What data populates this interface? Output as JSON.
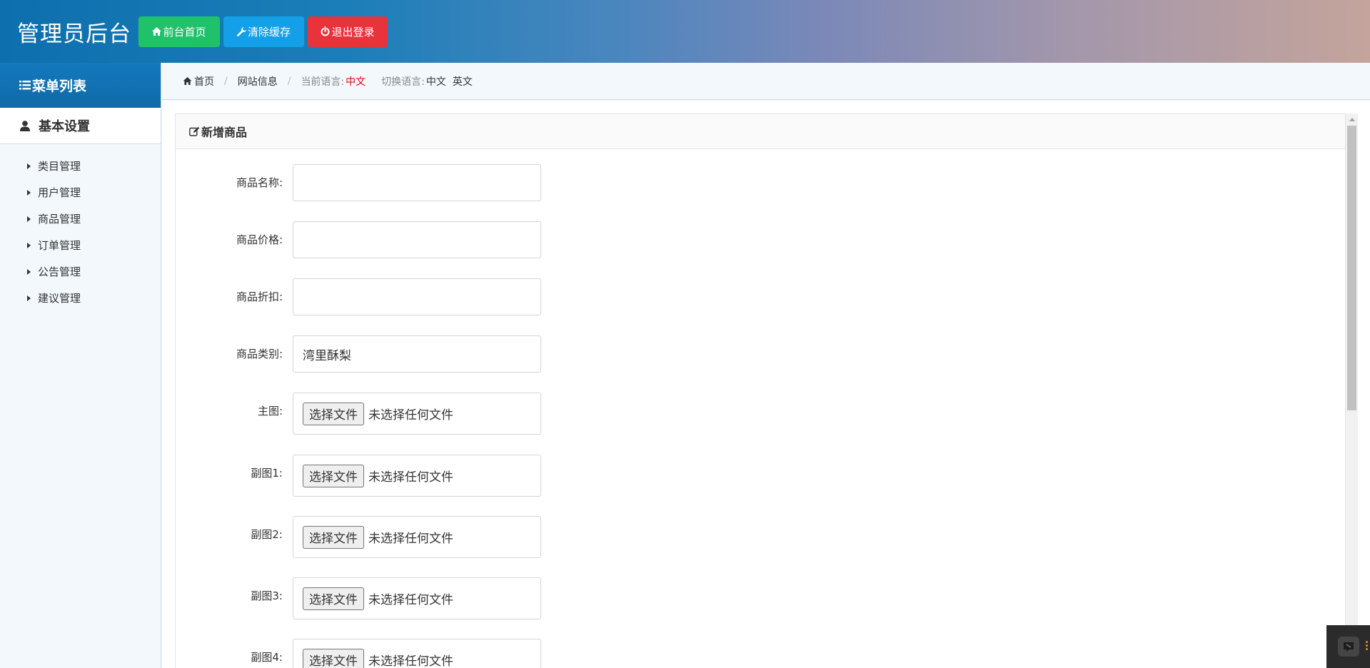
{
  "header": {
    "title": "管理员后台",
    "buttons": {
      "home": "前台首页",
      "clear_cache": "清除缓存",
      "logout": "退出登录"
    },
    "colors": {
      "home": "#1fc26a",
      "clear_cache": "#13a0e8",
      "logout": "#e8323c"
    }
  },
  "sidebar": {
    "menu_title": "菜单列表",
    "group_title": "基本设置",
    "items": [
      {
        "label": "类目管理"
      },
      {
        "label": "用户管理"
      },
      {
        "label": "商品管理"
      },
      {
        "label": "订单管理"
      },
      {
        "label": "公告管理"
      },
      {
        "label": "建议管理"
      }
    ]
  },
  "breadcrumb": {
    "home": "首页",
    "site_info": "网站信息",
    "current_lang_label": "当前语言:",
    "current_lang": "中文",
    "switch_lang_label": "切换语言:",
    "lang_zh": "中文",
    "lang_en": "英文",
    "separator": "/"
  },
  "panel": {
    "title": "新增商品"
  },
  "form": {
    "name": {
      "label": "商品名称:",
      "value": ""
    },
    "price": {
      "label": "商品价格:",
      "value": ""
    },
    "discount": {
      "label": "商品折扣:",
      "value": ""
    },
    "category": {
      "label": "商品类别:",
      "value": "湾里酥梨"
    },
    "file_button": "选择文件",
    "file_status": "未选择任何文件",
    "main_image": {
      "label": "主图:"
    },
    "sub_image_1": {
      "label": "副图1:"
    },
    "sub_image_2": {
      "label": "副图2:"
    },
    "sub_image_3": {
      "label": "副图3:"
    },
    "sub_image_4": {
      "label": "副图4:"
    }
  },
  "icons": {
    "home_button": "home-icon",
    "clear_cache_button": "wrench-icon",
    "logout_button": "power-icon",
    "menu_title": "list-icon",
    "group_title": "user-icon",
    "breadcrumb_home": "home-icon",
    "panel_title": "edit-icon",
    "menu_item": "caret-right-icon"
  }
}
